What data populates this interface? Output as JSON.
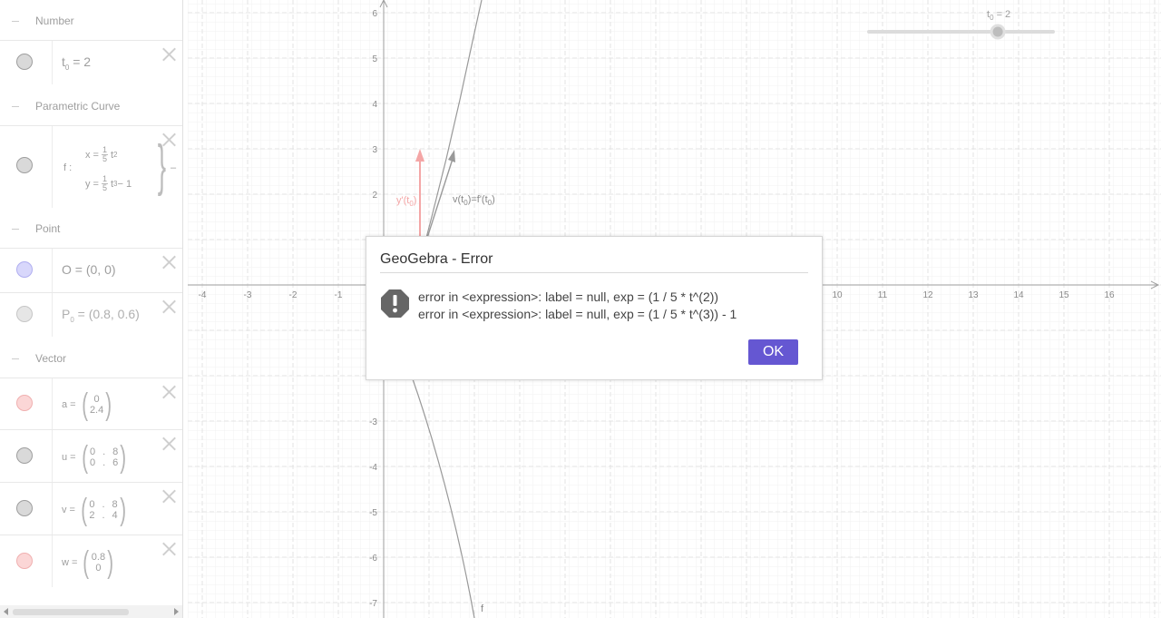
{
  "algebra": {
    "categories": {
      "number": "Number",
      "parametric_curve": "Parametric Curve",
      "point": "Point",
      "vector": "Vector"
    },
    "number": {
      "name": "t",
      "sub": "0",
      "rest": " = 2"
    },
    "curve": {
      "name": "f :",
      "x_lhs": "x =",
      "x_num": "1",
      "x_den": "5",
      "x_var": "t",
      "x_exp": "2",
      "y_lhs": "y =",
      "y_num": "1",
      "y_den": "5",
      "y_var": "t",
      "y_exp": "3",
      "y_rest": " − 1",
      "brace": "}",
      "tail": "–"
    },
    "point_o": "O = (0, 0)",
    "point_p": {
      "name": "P",
      "sub": "0",
      "rest": " = (0.8, 0.6)"
    },
    "vec_a": {
      "lhs": "a =",
      "top": "0",
      "bottom": "2.4"
    },
    "vec_u": {
      "lhs": "u =",
      "r1a": "0",
      "r1b": "8",
      "r2a": "0",
      "r2b": "6",
      "sep": "."
    },
    "vec_v": {
      "lhs": "v =",
      "r1a": "0",
      "r1b": "8",
      "r2a": "2",
      "r2b": "4",
      "sep": "."
    },
    "vec_w": {
      "lhs": "w =",
      "top": "0.8",
      "bottom": "0"
    }
  },
  "graphics": {
    "slider": {
      "name": "t",
      "sub": "0",
      "rest": " = 2",
      "value": 2,
      "min": -5,
      "max": 5
    },
    "labels": {
      "y_deriv": "y'(t",
      "y_deriv_sub": "0",
      "y_deriv_end": ")",
      "v_label": "v(t",
      "v_sub": "0",
      "v_mid": ")=f'(t",
      "v_sub2": "0",
      "v_end": ")",
      "curve_f": "f"
    },
    "x_ticks": [
      "-4",
      "-3",
      "-2",
      "-1",
      "10",
      "11",
      "12",
      "13",
      "14",
      "15",
      "16"
    ],
    "y_ticks": [
      "6",
      "5",
      "4",
      "3",
      "2",
      "-3",
      "-4",
      "-5",
      "-6",
      "-7"
    ]
  },
  "dialog": {
    "title": "GeoGebra - Error",
    "line1": "error in <expression>: label = null, exp = (1 / 5 * t^(2))",
    "line2": "error in <expression>: label = null, exp = (1 / 5 * t^(3)) - 1",
    "ok": "OK"
  },
  "colors": {
    "accent": "#6557d2",
    "vector_red": "#f4a6a6",
    "point_blue": "#9e9cf0",
    "axis": "#9e9e9e"
  }
}
